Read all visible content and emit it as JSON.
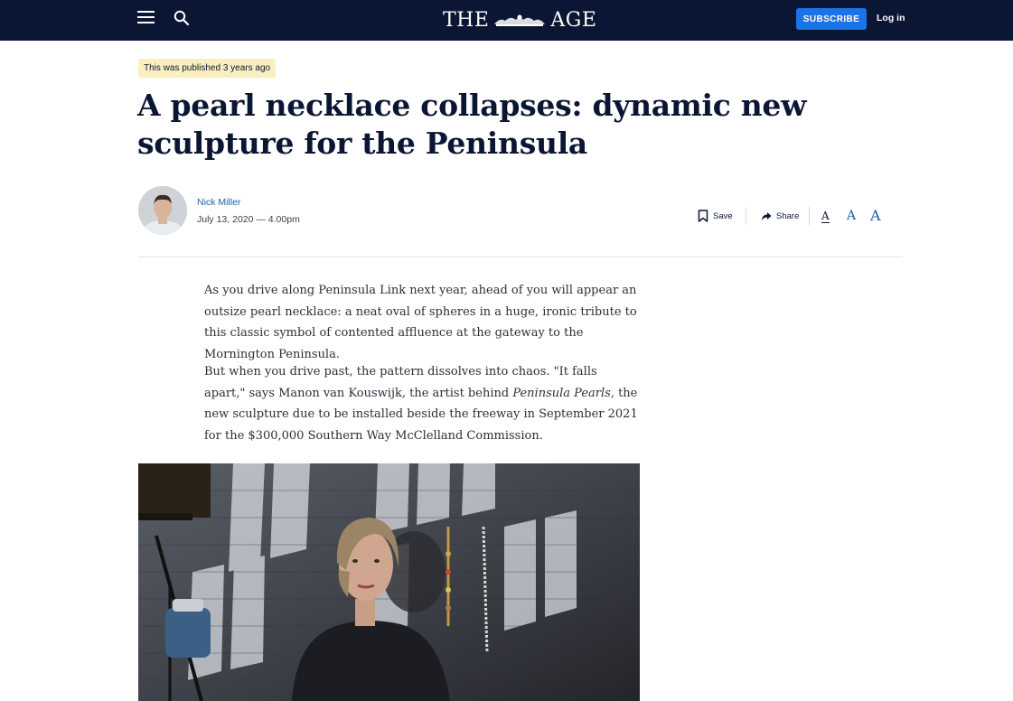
{
  "header": {
    "logo_left": "THE",
    "logo_right": "AGE",
    "subscribe_label": "SUBSCRIBE",
    "login_label": "Log in",
    "background_color": "#0a1633",
    "accent_color": "#1a73e8"
  },
  "article": {
    "age_badge": "This was published 3 years ago",
    "headline": "A pearl necklace collapses: dynamic new sculpture for the Peninsula",
    "author": "Nick Miller",
    "dateline": "July 13, 2020 — 4.00pm",
    "paragraph1": "As you drive along Peninsula Link next year, ahead of you will appear an outsize pearl necklace: a neat oval of spheres in a huge, ironic tribute to this classic symbol of contented affluence at the gateway to the Mornington Peninsula.",
    "paragraph2_part1": "But when you drive past, the pattern dissolves into chaos. \"It falls apart,\" says Manon van Kouswijk, the artist behind ",
    "paragraph2_italic": "Peninsula Pearls,",
    "paragraph2_part2": " the new sculpture due to be installed beside the freeway in September 2021 for the $300,000 Southern Way McClelland Commission."
  },
  "tools": {
    "save_label": "Save",
    "share_label": "Share",
    "font_small": "A",
    "font_medium": "A",
    "font_large": "A"
  },
  "icons": [
    "menu-icon",
    "search-icon",
    "bookmark-icon",
    "share-arrow-icon"
  ]
}
